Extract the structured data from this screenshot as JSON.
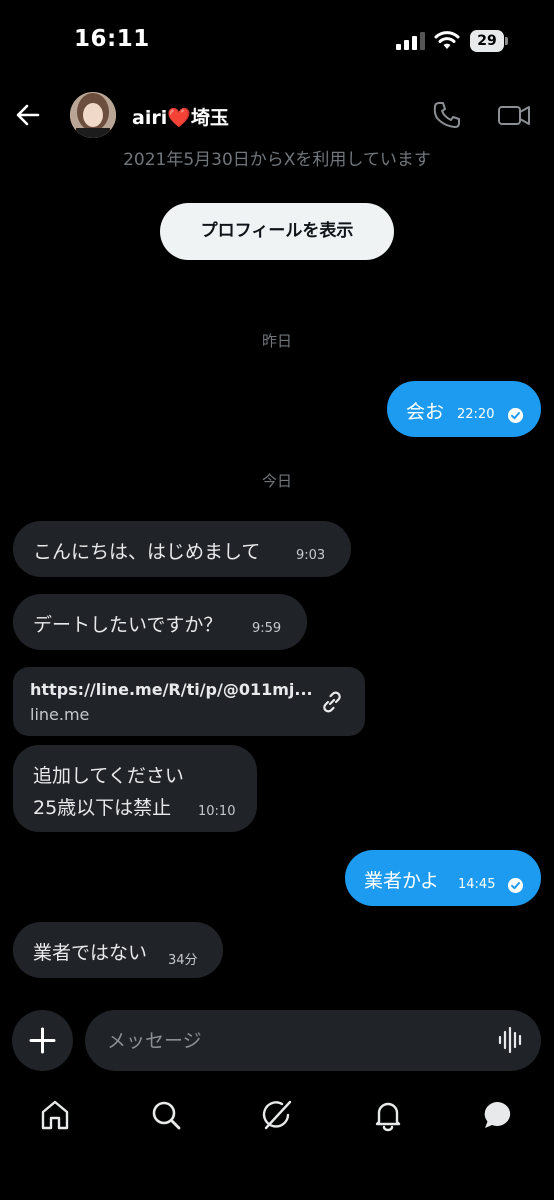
{
  "status_bar": {
    "time": "16:11",
    "battery_level": "29"
  },
  "header": {
    "contact_name": "airi❤️埼玉"
  },
  "profile": {
    "joined_text": "2021年5月30日からXを利用しています",
    "view_profile_label": "プロフィールを表示"
  },
  "date_separators": {
    "yesterday": "昨日",
    "today": "今日"
  },
  "messages": [
    {
      "direction": "out",
      "text": "会お",
      "time": "22:20",
      "read": true
    },
    {
      "direction": "in",
      "text": "こんにちは、はじめまして",
      "time": "9:03"
    },
    {
      "direction": "in",
      "text": "デートしたいですか？",
      "time": "9:59"
    },
    {
      "direction": "in",
      "type": "link",
      "url": "https://line.me/R/ti/p/@011mj...",
      "domain": "line.me"
    },
    {
      "direction": "in",
      "line1": "追加してください",
      "line2": "25歳以下は禁止",
      "time": "10:10"
    },
    {
      "direction": "out",
      "text": "業者かよ",
      "time": "14:45",
      "read": true
    },
    {
      "direction": "in",
      "text": "業者ではない",
      "time": "34分"
    }
  ],
  "composer": {
    "placeholder": "メッセージ"
  },
  "tabs": [
    "home",
    "search",
    "grok",
    "notifications",
    "messages"
  ],
  "colors": {
    "background": "#000000",
    "incoming_bubble": "#202327",
    "outgoing_bubble": "#1d9bf0",
    "muted_text": "#71767b"
  }
}
